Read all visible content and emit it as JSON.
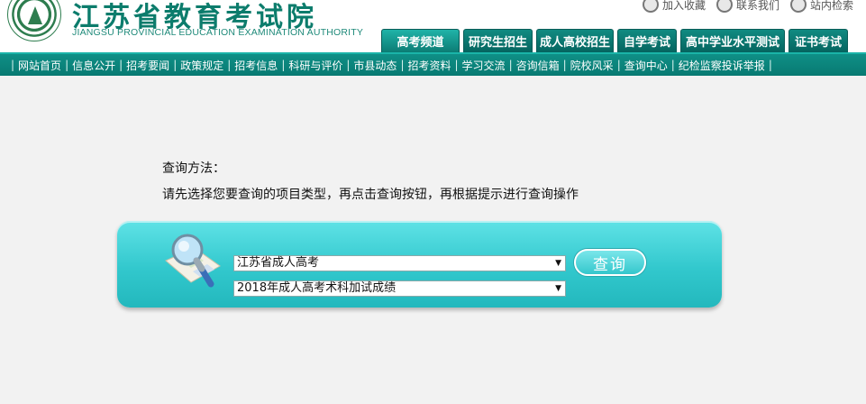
{
  "header": {
    "title": "江苏省教育考试院",
    "subtitle": "JIANGSU PROVINCIAL EDUCATION EXAMINATION AUTHORITY",
    "toplinks": [
      "加入收藏",
      "联系我们",
      "站内检索"
    ]
  },
  "tabs": [
    "高考频道",
    "研究生招生",
    "成人高校招生",
    "自学考试",
    "高中学业水平测试",
    "证书考试"
  ],
  "nav": [
    "网站首页",
    "信息公开",
    "招考要闻",
    "政策规定",
    "招考信息",
    "科研与评价",
    "市县动态",
    "招考资料",
    "学习交流",
    "咨询信箱",
    "院校风采",
    "查询中心",
    "纪检监察投诉举报"
  ],
  "main": {
    "method_title": "查询方法：",
    "method_text": "请先选择您要查询的项目类型，再点击查询按钮，再根据提示进行查询操作",
    "select1": "江苏省成人高考",
    "select2": "2018年成人高考术科加试成绩",
    "query_button": "查询"
  },
  "colors": {
    "brand": "#0c7c6c",
    "nav_bg": "#0f8f86",
    "query_box": "#32c8cd"
  }
}
